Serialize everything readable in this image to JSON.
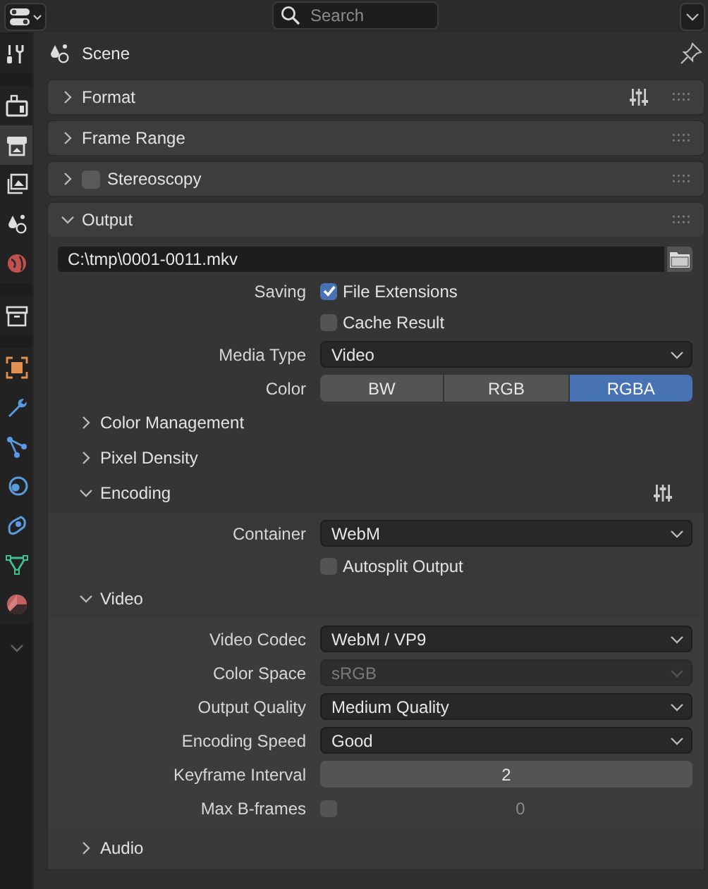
{
  "header": {
    "search": {
      "placeholder": "Search"
    }
  },
  "tab_groups": [
    {
      "tabs": [
        {
          "kind": "tool",
          "selected": false
        }
      ]
    },
    {
      "tabs": [
        {
          "kind": "render",
          "selected": false
        },
        {
          "kind": "output",
          "selected": true
        },
        {
          "kind": "view_layer",
          "selected": false
        },
        {
          "kind": "scene",
          "selected": false
        },
        {
          "kind": "world",
          "selected": false
        }
      ]
    },
    {
      "tabs": [
        {
          "kind": "collection",
          "selected": false
        }
      ]
    },
    {
      "tabs": [
        {
          "kind": "object",
          "selected": false
        },
        {
          "kind": "modifiers",
          "selected": false
        },
        {
          "kind": "particles",
          "selected": false
        },
        {
          "kind": "physics",
          "selected": false
        },
        {
          "kind": "constraints",
          "selected": false
        },
        {
          "kind": "data",
          "selected": false
        },
        {
          "kind": "material",
          "selected": false
        }
      ]
    }
  ],
  "context": {
    "title": "Scene"
  },
  "panels": [
    {
      "title": "Format",
      "expanded": false,
      "presets": true
    },
    {
      "title": "Frame Range",
      "expanded": false
    },
    {
      "title": "Stereoscopy",
      "expanded": false,
      "checkbox": {
        "checked": false
      }
    },
    {
      "title": "Output",
      "expanded": true,
      "rows": [
        {
          "kind": "file_path",
          "value": "C:\\tmp\\0001-0011.mkv"
        },
        {
          "kind": "checkbox",
          "label": "Saving",
          "text": "File Extensions",
          "checked": true
        },
        {
          "kind": "checkbox",
          "text": "Cache Result",
          "checked": false
        },
        {
          "kind": "dropdown",
          "label": "Media Type",
          "value": "Video",
          "disabled": false
        },
        {
          "kind": "segmented",
          "label": "Color",
          "options": [
            {
              "label": "BW",
              "selected": false
            },
            {
              "label": "RGB",
              "selected": false
            },
            {
              "label": "RGBA",
              "selected": true
            }
          ]
        },
        {
          "kind": "subpanel",
          "title": "Color Management",
          "expanded": false
        },
        {
          "kind": "subpanel",
          "title": "Pixel Density",
          "expanded": false
        },
        {
          "kind": "subpanel",
          "title": "Encoding",
          "expanded": true,
          "presets": true,
          "rows": [
            {
              "kind": "dropdown",
              "label": "Container",
              "value": "WebM",
              "disabled": false
            },
            {
              "kind": "checkbox",
              "text": "Autosplit Output",
              "checked": false
            },
            {
              "kind": "subpanel",
              "title": "Video",
              "expanded": true,
              "rows": [
                {
                  "kind": "dropdown",
                  "label": "Video Codec",
                  "value": "WebM / VP9",
                  "disabled": false
                },
                {
                  "kind": "dropdown",
                  "label": "Color Space",
                  "value": "sRGB",
                  "disabled": true
                },
                {
                  "kind": "dropdown",
                  "label": "Output Quality",
                  "value": "Medium Quality",
                  "disabled": false
                },
                {
                  "kind": "dropdown",
                  "label": "Encoding Speed",
                  "value": "Good",
                  "disabled": false
                },
                {
                  "kind": "number",
                  "label": "Keyframe Interval",
                  "value": "2",
                  "disabled": false
                },
                {
                  "kind": "check_number",
                  "label": "Max B-frames",
                  "checked": false,
                  "value": "0",
                  "disabled": true
                }
              ]
            },
            {
              "kind": "subpanel",
              "title": "Audio",
              "expanded": false
            }
          ]
        }
      ]
    }
  ]
}
